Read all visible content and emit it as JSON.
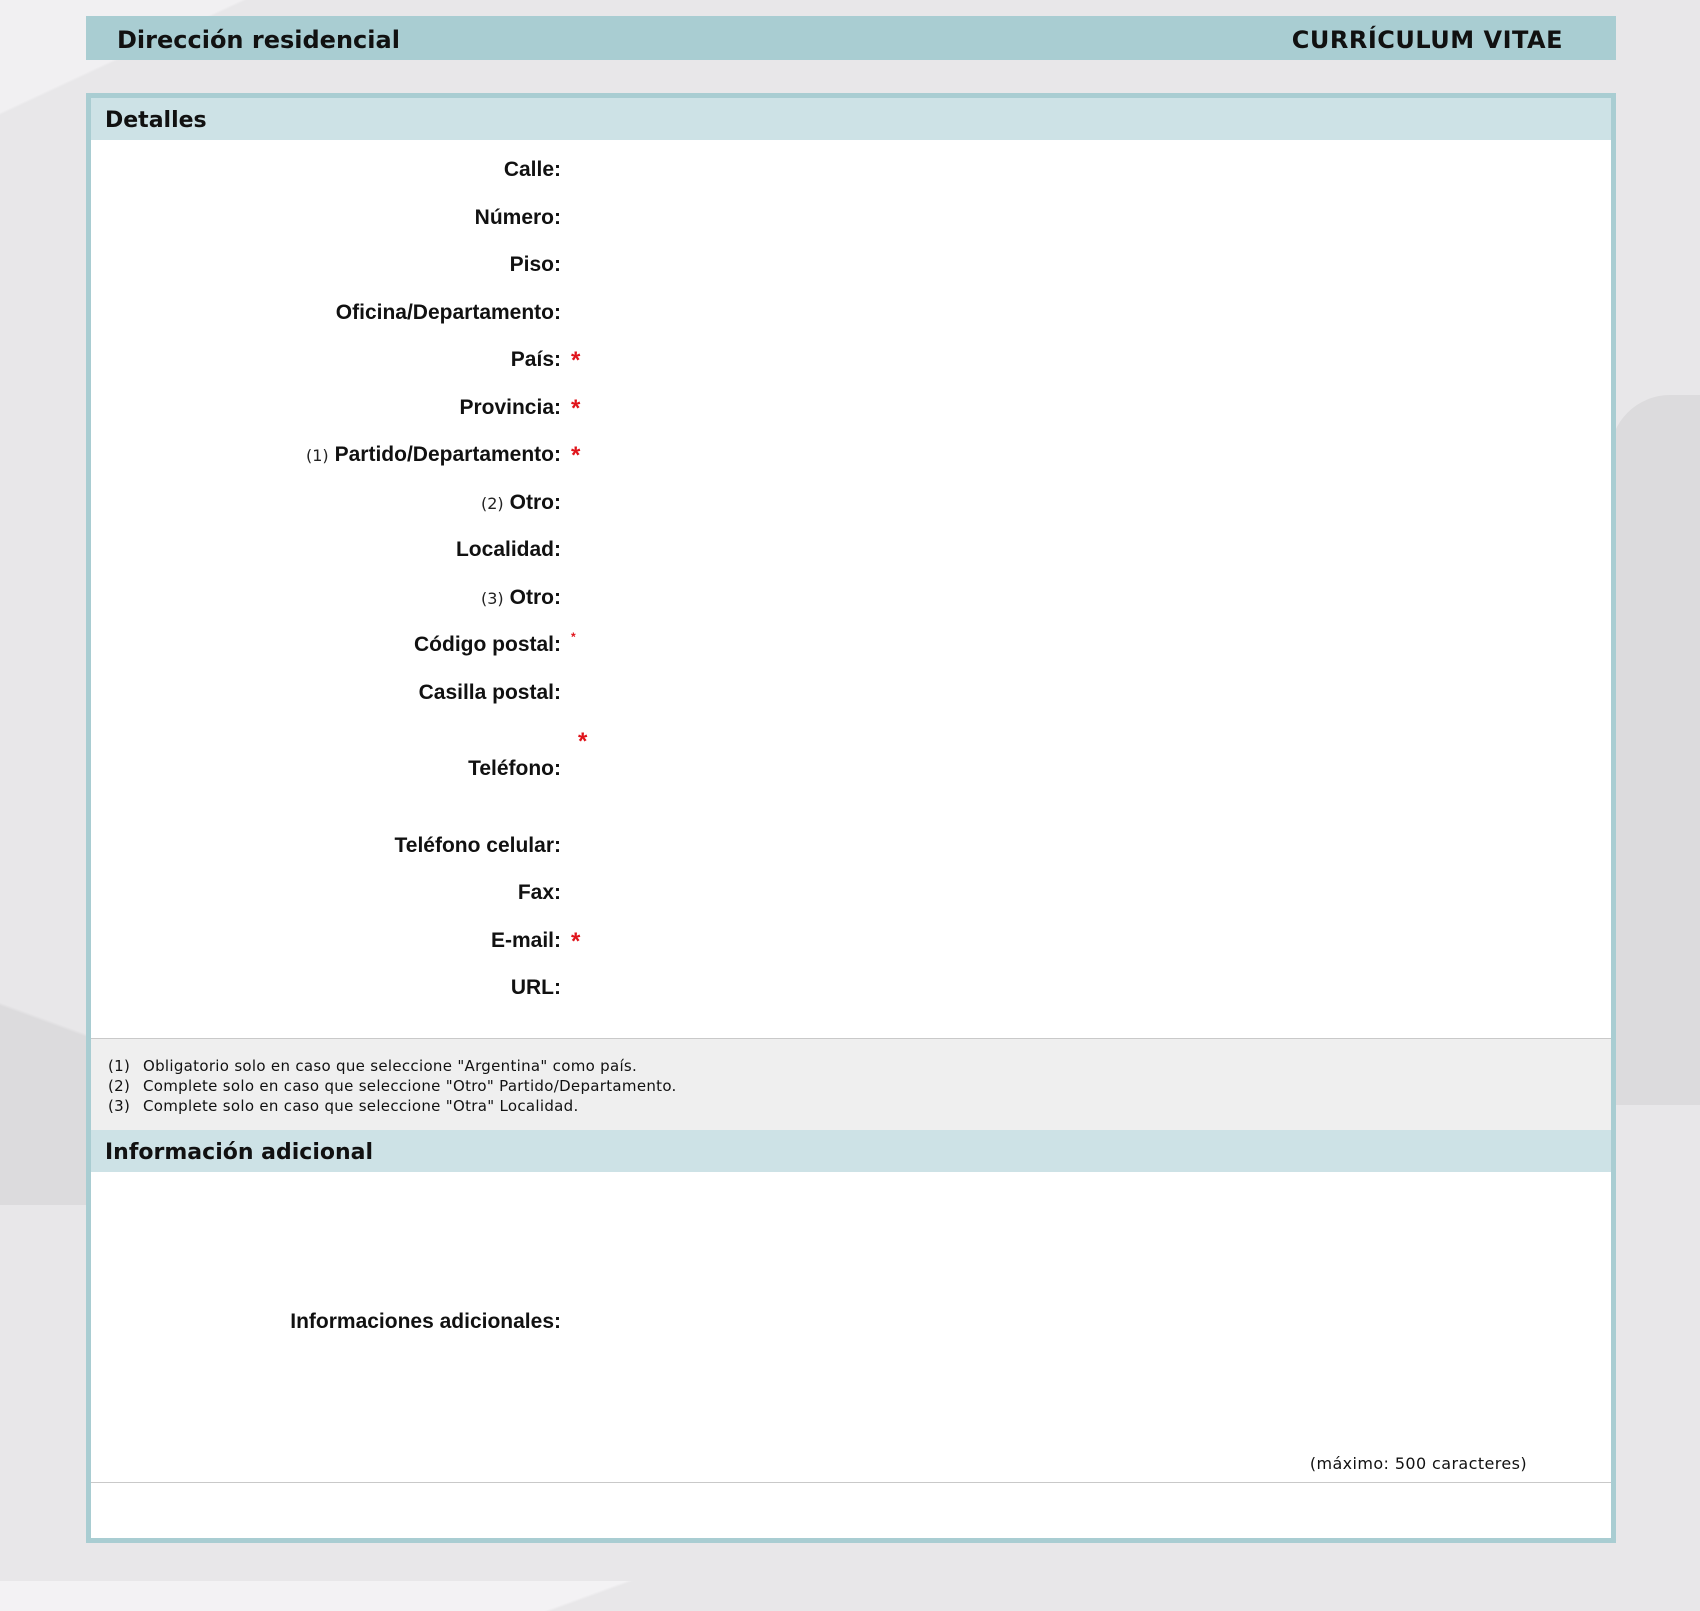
{
  "header": {
    "left_title": "Dirección residencial",
    "right_title": "CURRÍCULUM VITAE"
  },
  "details": {
    "title": "Detalles",
    "fields": [
      {
        "label": "Calle:",
        "note": "",
        "required": false
      },
      {
        "label": "Número:",
        "note": "",
        "required": false
      },
      {
        "label": "Piso:",
        "note": "",
        "required": false
      },
      {
        "label": "Oficina/Departamento:",
        "note": "",
        "required": false
      },
      {
        "label": "País:",
        "note": "",
        "required": true
      },
      {
        "label": "Provincia:",
        "note": "",
        "required": true
      },
      {
        "label": "Partido/Departamento:",
        "note": "(1)",
        "required": true
      },
      {
        "label": "Otro:",
        "note": "(2)",
        "required": false
      },
      {
        "label": "Localidad:",
        "note": "",
        "required": false
      },
      {
        "label": "Otro:",
        "note": "(3)",
        "required": false
      },
      {
        "label": "Código postal:",
        "note": "",
        "required": true
      },
      {
        "label": "Casilla postal:",
        "note": "",
        "required": false
      },
      {
        "label": "Teléfono:",
        "note": "",
        "required": true
      },
      {
        "label": "Teléfono celular:",
        "note": "",
        "required": false
      },
      {
        "label": "Fax:",
        "note": "",
        "required": false
      },
      {
        "label": "E-mail:",
        "note": "",
        "required": true
      },
      {
        "label": "URL:",
        "note": "",
        "required": false
      }
    ],
    "required_marker": "*"
  },
  "footnotes": [
    {
      "num": "(1)",
      "text": "Obligatorio solo en caso que seleccione \"Argentina\" como país."
    },
    {
      "num": "(2)",
      "text": "Complete solo en caso que seleccione \"Otro\" Partido/Departamento."
    },
    {
      "num": "(3)",
      "text": "Complete solo en caso que seleccione \"Otra\" Localidad."
    }
  ],
  "additional": {
    "title": "Información adicional",
    "label": "Informaciones adicionales:",
    "max_chars": "(máximo: 500 caracteres)"
  },
  "colors": {
    "header_bg": "#a9cdd2",
    "section_bg": "#cde2e6",
    "required": "#e0141b"
  }
}
